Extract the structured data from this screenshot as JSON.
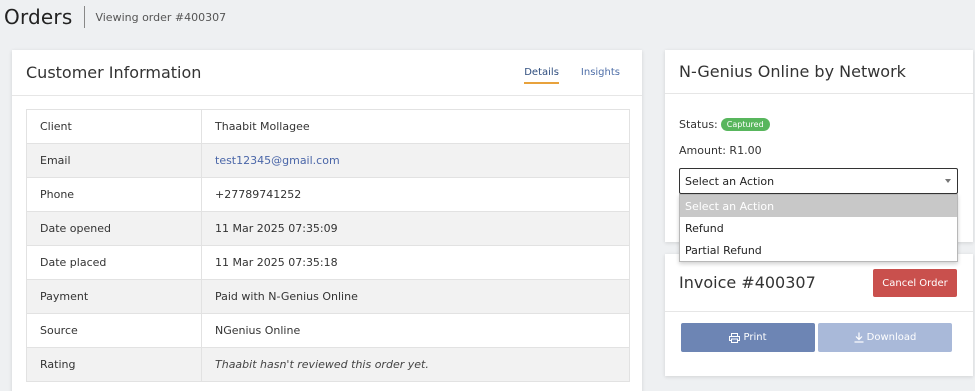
{
  "header": {
    "title": "Orders",
    "subtitle": "Viewing order #400307"
  },
  "customer": {
    "title": "Customer Information",
    "tabs": [
      {
        "label": "Details",
        "active": true
      },
      {
        "label": "Insights",
        "active": false
      }
    ],
    "rows": [
      {
        "label": "Client",
        "value": "Thaabit Mollagee"
      },
      {
        "label": "Email",
        "value": "test12345@gmail.com"
      },
      {
        "label": "Phone",
        "value": "+27789741252"
      },
      {
        "label": "Date opened",
        "value": "11 Mar 2025 07:35:09"
      },
      {
        "label": "Date placed",
        "value": "11 Mar 2025 07:35:18"
      },
      {
        "label": "Payment",
        "value": "Paid with N-Genius Online"
      },
      {
        "label": "Source",
        "value": "NGenius Online"
      },
      {
        "label": "Rating",
        "value": "Thaabit hasn't reviewed this order yet."
      }
    ]
  },
  "ngenius": {
    "title": "N-Genius Online by Network",
    "status_label": "Status:",
    "status_badge": "Captured",
    "amount_label": "Amount: R1.00",
    "select_value": "Select an Action",
    "options": [
      "Select an Action",
      "Refund",
      "Partial Refund"
    ]
  },
  "invoice": {
    "title": "Invoice #400307",
    "cancel_label": "Cancel Order",
    "print_label": "Print",
    "download_label": "Download"
  },
  "colors": {
    "accent": "#e8a23c",
    "badge": "#58b65d",
    "cancel": "#c9504d",
    "print": "#6d85b4",
    "download": "#a9b9d9"
  }
}
